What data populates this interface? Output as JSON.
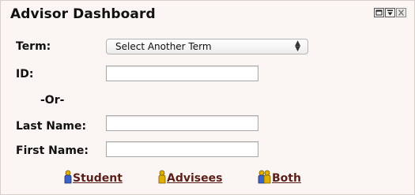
{
  "panel": {
    "title": "Advisor Dashboard",
    "controls": [
      {
        "icon": "restore-window-icon"
      },
      {
        "icon": "minimize-window-icon"
      },
      {
        "icon": "close-window-icon"
      }
    ]
  },
  "form": {
    "term_label": "Term:",
    "term_value": "Select Another Term",
    "id_label": "ID:",
    "id_value": "",
    "or_label": "-Or-",
    "last_name_label": "Last Name:",
    "last_name_value": "",
    "first_name_label": "First Name:",
    "first_name_value": ""
  },
  "links": [
    {
      "label": "Student",
      "icon": "single-person-icon"
    },
    {
      "label": "Advisees",
      "icon": "single-person-icon"
    },
    {
      "label": "Both",
      "icon": "two-people-icon"
    }
  ],
  "colors": {
    "background": "#fbf6f3",
    "link": "#5b1f1a"
  }
}
